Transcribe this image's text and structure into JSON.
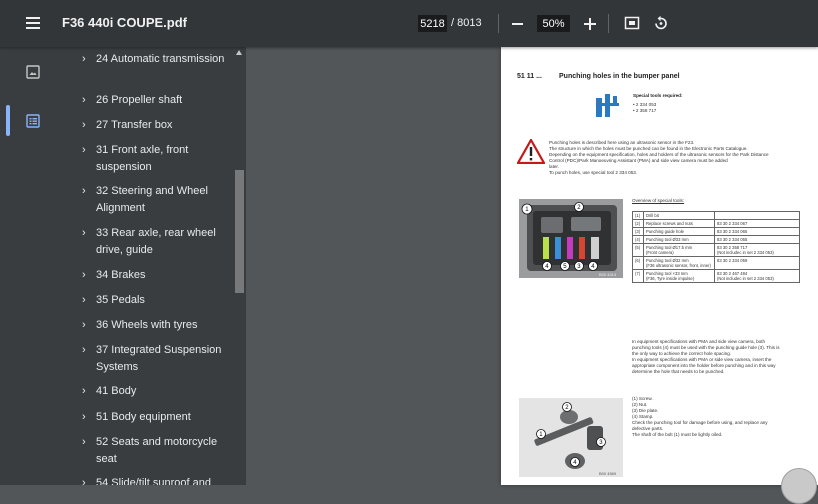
{
  "toolbar": {
    "doc_title": "F36 440i COUPE.pdf",
    "page_current": "5218",
    "page_total": "/ 8013",
    "zoom": "50%",
    "icons": [
      "menu-icon",
      "zoom-out-icon",
      "zoom-in-icon",
      "fit-page-icon",
      "rotate-icon"
    ]
  },
  "rail": {
    "items": [
      {
        "name": "thumbnails-icon",
        "active": false
      },
      {
        "name": "document-outline-icon",
        "active": true
      }
    ],
    "active_color": "#8ab4f8"
  },
  "outline": {
    "items": [
      {
        "label": "24 Automatic transmission"
      },
      {
        "label": "26 Propeller shaft"
      },
      {
        "label": "27 Transfer box"
      },
      {
        "label": "31 Front axle, front suspension"
      },
      {
        "label": "32 Steering and Wheel Alignment"
      },
      {
        "label": "33 Rear axle, rear wheel drive, guide"
      },
      {
        "label": "34 Brakes"
      },
      {
        "label": "35 Pedals"
      },
      {
        "label": "36 Wheels with tyres"
      },
      {
        "label": "37 Integrated Suspension Systems"
      },
      {
        "label": "41 Body"
      },
      {
        "label": "51 Body equipment"
      },
      {
        "label": "52 Seats and motorcycle seat"
      },
      {
        "label": "54 Slide/tilt sunroof and"
      }
    ]
  },
  "page": {
    "section_number": "51 11 ...",
    "heading": "Punching holes in the bumper panel",
    "special_tools_label": "Special tools required:",
    "special_tools": [
      "2 334 053",
      "2 358 717"
    ],
    "warning_lines": [
      "Punching holes is described here using an ultrasonic sensor in the F23.",
      "The structure in which the holes must be punched can be found in the Electronic Parts Catalogue.",
      "Depending on the equipment specification, holes and holders of the ultrasonic sensors for the Park Distance",
      "Control (PDC)/Park Manoeuvring Assistant (PMA) and side view camera must be added",
      "later.",
      "To punch holes, use special tool 2 334 053."
    ],
    "overview_label": "Overview of special tools:",
    "tools": [
      {
        "n": "(1)",
        "part": "Drill bit",
        "number": "",
        "note": ""
      },
      {
        "n": "(2)",
        "part": "Replace screws and nuts",
        "number": "83 30 2 334 067",
        "note": ""
      },
      {
        "n": "(3)",
        "part": "Punching guide hole",
        "number": "83 30 2 334 065",
        "note": ""
      },
      {
        "n": "(4)",
        "part": "Punching tool Ø33 mm",
        "number": "83 30 2 334 055",
        "note": ""
      },
      {
        "n": "(5)",
        "part": "Punching tool Ø17.5 mm",
        "number": "83 30 2 358 717",
        "note": "(Front camera)",
        "extra": "(Not includec in set 2 334 053)"
      },
      {
        "n": "(6)",
        "part": "Punching tool Ø32 mm",
        "number": "83 30 2 334 059",
        "note": "(F36 ultrasonic sensor, front, inner)",
        "extra": ""
      },
      {
        "n": "(7)",
        "part": "Punching tool ×33 mm",
        "number": "83 30 2 467 484",
        "note": "(F36, Tyre inside impulse)",
        "extra": "(Not includec in set 2 334 053)"
      }
    ],
    "notes": [
      "In equipment specifications with PMA and side view camera, both",
      "punching tools (4) must be used with the punching guide hole (3). This is",
      "the only way to achieve the correct hole spacing.",
      "In equipment specifications with PMA or side view camera, insert the",
      "appropriate component into the holder before punching and in this way",
      "determine the hole that needs to be punched."
    ],
    "parts": [
      "(1) Screw.",
      "(2) Nut.",
      "(3) Die plate.",
      "(4) Stamp.",
      "Check the punching tool for damage before using, and replace any",
      "defective parts.",
      "The shaft of the bolt (1) must be lightly oiled."
    ],
    "image1_caption": "B00 4314",
    "image2_caption": "B00 4569"
  }
}
